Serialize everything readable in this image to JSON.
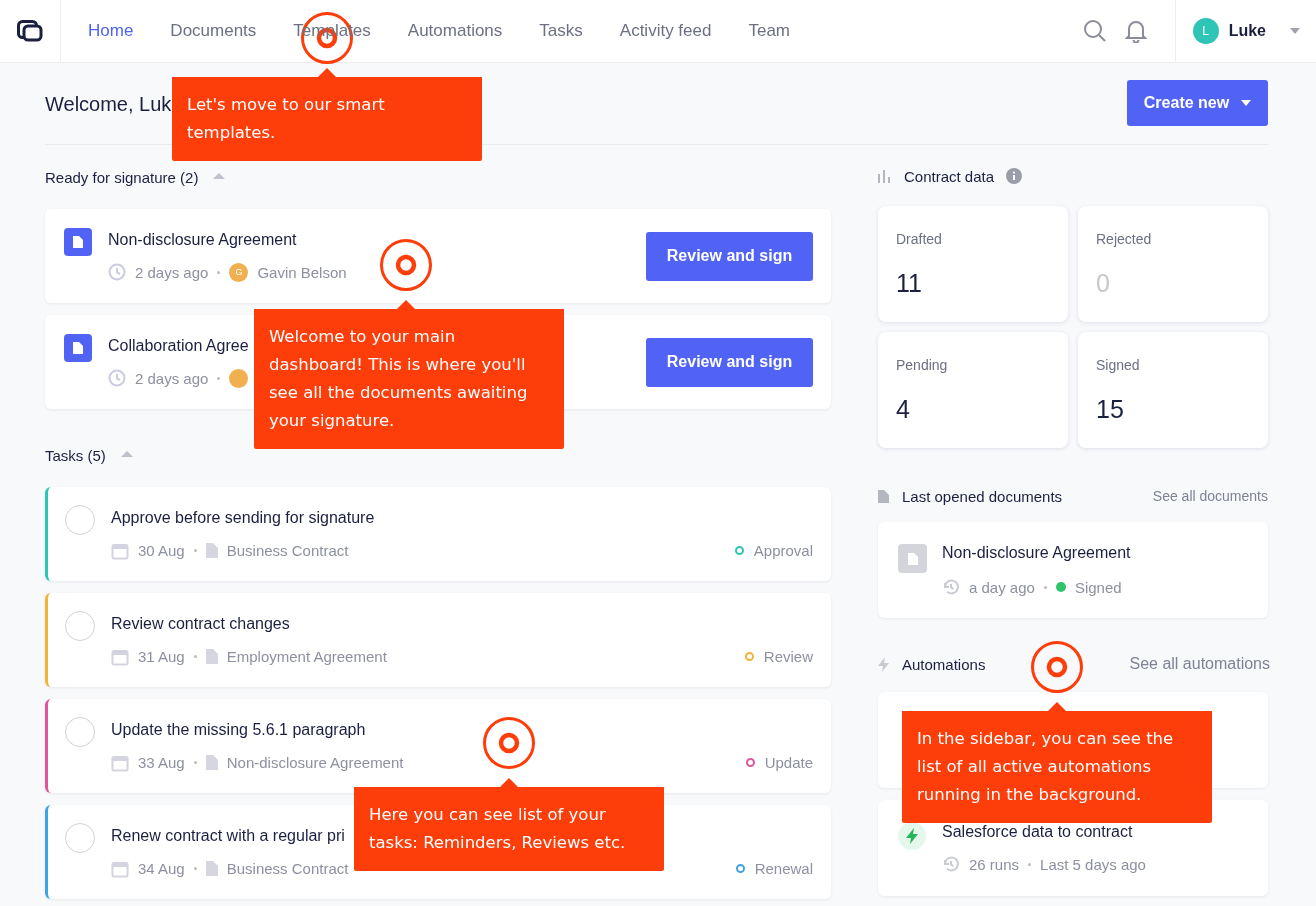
{
  "nav": {
    "items": [
      {
        "label": "Home",
        "selected": true
      },
      {
        "label": "Documents",
        "selected": false
      },
      {
        "label": "Templates",
        "selected": false
      },
      {
        "label": "Automations",
        "selected": false
      },
      {
        "label": "Tasks",
        "selected": false
      },
      {
        "label": "Activity feed",
        "selected": false
      },
      {
        "label": "Team",
        "selected": false
      }
    ],
    "user": {
      "initial": "L",
      "name": "Luke"
    }
  },
  "header": {
    "welcome": "Welcome, Luk",
    "create_button": "Create new"
  },
  "signature": {
    "title": "Ready for signature (2)",
    "expanded": true,
    "items": [
      {
        "title": "Non-disclosure Agreement",
        "time": "2 days ago",
        "avatar": "G",
        "person": "Gavin Belson",
        "button": "Review and sign"
      },
      {
        "title": "Collaboration Agree",
        "time": "2 days ago",
        "button": "Review and sign"
      }
    ]
  },
  "tasks": {
    "title": "Tasks (5)",
    "expanded": true,
    "items": [
      {
        "title": "Approve before sending for signature",
        "checked": false,
        "date": "30 Aug",
        "document": "Business Contract",
        "tag": "Approval",
        "color": "#2ec4b6"
      },
      {
        "title": "Review contract changes",
        "checked": false,
        "date": "31 Aug",
        "document": "Employment Agreement",
        "tag": "Review",
        "color": "#f0b43c"
      },
      {
        "title": "Update the missing 5.6.1 paragraph",
        "checked": false,
        "date": "33 Aug",
        "document": "Non-disclosure Agreement",
        "tag": "Update",
        "color": "#e0569b"
      },
      {
        "title": "Renew contract with a regular pri",
        "checked": false,
        "date": "34  Aug",
        "document": "Business Contract",
        "tag": "Renewal",
        "color": "#3fa3e6"
      }
    ]
  },
  "contract_data": {
    "title": "Contract data",
    "stats": [
      {
        "label": "Drafted",
        "value": "11",
        "muted": false
      },
      {
        "label": "Rejected",
        "value": "0",
        "muted": true
      },
      {
        "label": "Pending",
        "value": "4",
        "muted": false
      },
      {
        "label": "Signed",
        "value": "15",
        "muted": false
      }
    ]
  },
  "last_opened": {
    "title": "Last opened documents",
    "link": "See all documents",
    "items": [
      {
        "title": "Non-disclosure Agreement",
        "time": "a day ago",
        "status": "Signed",
        "color": "#2fc36b"
      }
    ]
  },
  "automations": {
    "title": "Automations",
    "link": "See all automations",
    "items": [
      {
        "kind": "hidden"
      },
      {
        "kind": "automation",
        "title": "Salesforce data to contract",
        "runs": "26 runs",
        "last": "Last 5 days ago"
      }
    ]
  },
  "tour_tips": [
    {
      "text": "Let's move to our smart templates."
    },
    {
      "text": "Welcome to your main dashboard! This is where you'll see all the documents awaiting your signature."
    },
    {
      "text": "Here you can see list of your tasks: Reminders, Reviews etc."
    },
    {
      "text": "In the sidebar, you can see the list of all active automations running in the background."
    }
  ]
}
